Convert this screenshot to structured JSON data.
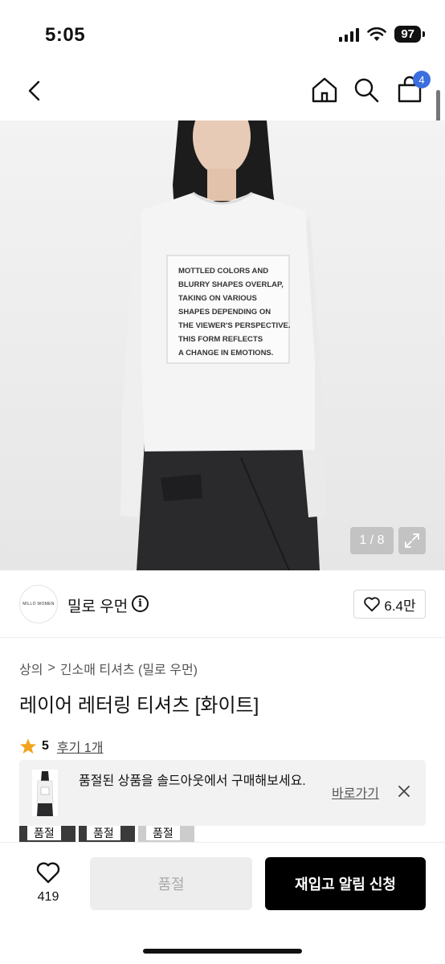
{
  "status_bar": {
    "time": "5:05",
    "battery": "97"
  },
  "nav": {
    "cart_count": "4"
  },
  "product_image": {
    "print_text": [
      "MOTTLED COLORS AND",
      "BLURRY SHAPES OVERLAP,",
      "TAKING ON VARIOUS",
      "SHAPES DEPENDING ON",
      "THE VIEWER'S PERSPECTIVE.",
      "THIS FORM REFLECTS",
      "A CHANGE IN EMOTIONS."
    ],
    "counter": "1 / 8"
  },
  "brand": {
    "logo_text": "MILLO WOMEN",
    "name": "밀로 우먼",
    "likes": "6.4만"
  },
  "breadcrumb": {
    "category": "상의",
    "separator": ">",
    "subcategory": "긴소매 티셔츠 (밀로 우먼)"
  },
  "product": {
    "title": "레이어 레터링 티셔츠 [화이트]"
  },
  "rating": {
    "score": "5",
    "reviews": "후기 1개"
  },
  "soldout_banner": {
    "text": "품절된 상품을 솔드아웃에서 구매해보세요.",
    "link": "바로가기"
  },
  "options": [
    {
      "label": "품절"
    },
    {
      "label": "품절"
    },
    {
      "label": "품절"
    }
  ],
  "bottom_bar": {
    "wish_count": "419",
    "soldout_label": "품절",
    "restock_label": "재입고 알림 신청"
  },
  "colors": {
    "accent_badge": "#3b6fe0",
    "star": "#f2a31c"
  }
}
